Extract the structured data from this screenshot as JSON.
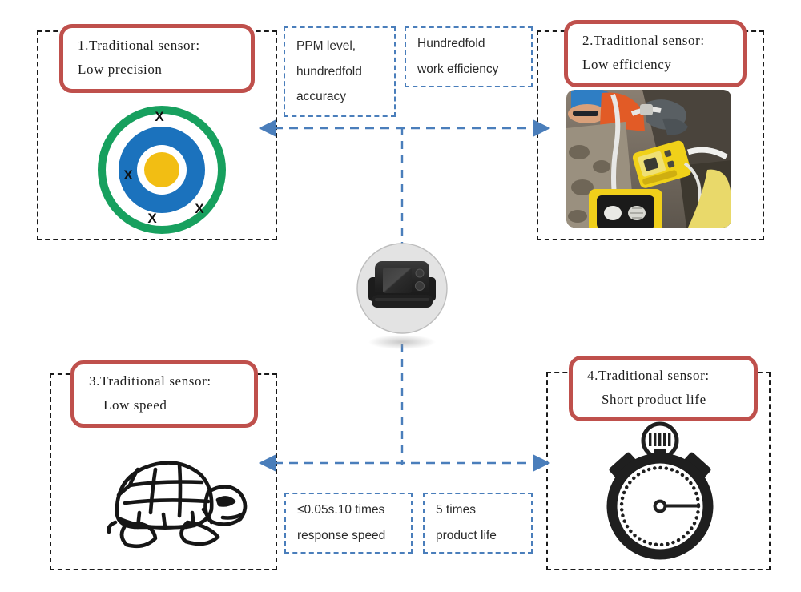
{
  "diagram": {
    "title_context": "Traditional sensor comparison diagram",
    "colors": {
      "red_box_border": "#bf504c",
      "blue_dashed": "#4a7ebb",
      "black_dashed": "#1a1a1a",
      "target_green": "#17a05e",
      "target_blue": "#1b72bd",
      "target_yellow": "#f2be13",
      "badge_fill": "#e3e3e3",
      "device_dark": "#2b2b2b"
    }
  },
  "quadrants": [
    {
      "id": "tl",
      "label_line1": "1.Traditional sensor:",
      "label_line2": "Low precision",
      "icon": "target-icon",
      "icon_marks": [
        "X",
        "X",
        "X",
        "X"
      ]
    },
    {
      "id": "tr",
      "label_line1": "2.Traditional sensor:",
      "label_line2": "Low efficiency",
      "icon": "field-worker-photo"
    },
    {
      "id": "bl",
      "label_line1": "3.Traditional sensor:",
      "label_line2": "Low speed",
      "icon": "turtle-icon"
    },
    {
      "id": "br",
      "label_line1": "4.Traditional sensor:",
      "label_line2": "Short product life",
      "icon": "stopwatch-icon"
    }
  ],
  "callouts": {
    "ppm": {
      "line1": "PPM level,",
      "line2": "hundredfold",
      "line3": "accuracy"
    },
    "work": {
      "line1": "Hundredfold",
      "line2": "work efficiency"
    },
    "response": {
      "line1": "≤0.05s.10 times",
      "line2": "response speed"
    },
    "life": {
      "line1": "5 times",
      "line2": "product life"
    }
  },
  "center": {
    "name": "gas-sensor-device"
  }
}
